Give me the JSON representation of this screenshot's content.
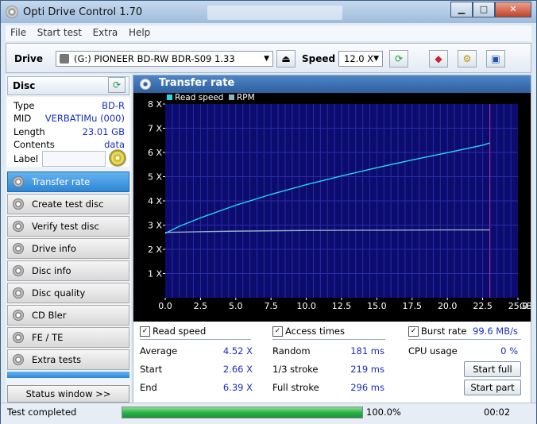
{
  "window": {
    "title": "Opti Drive Control 1.70",
    "min": "▁",
    "max": "□",
    "close": "✕"
  },
  "menu": [
    "File",
    "Start test",
    "Extra",
    "Help"
  ],
  "toolbar": {
    "drive_label": "Drive",
    "drive_value": "(G:)  PIONEER BD-RW   BDR-S09 1.33",
    "speed_label": "Speed",
    "speed_value": "12.0 X"
  },
  "disc": {
    "header": "Disc",
    "rows": [
      {
        "label": "Type",
        "value": "BD-R"
      },
      {
        "label": "MID",
        "value": "VERBATIMu (000)"
      },
      {
        "label": "Length",
        "value": "23.01 GB"
      },
      {
        "label": "Contents",
        "value": "data"
      }
    ],
    "label_field": "Label"
  },
  "nav": [
    {
      "label": "Transfer rate",
      "active": true
    },
    {
      "label": "Create test disc",
      "active": false
    },
    {
      "label": "Verify test disc",
      "active": false
    },
    {
      "label": "Drive info",
      "active": false
    },
    {
      "label": "Disc info",
      "active": false
    },
    {
      "label": "Disc quality",
      "active": false
    },
    {
      "label": "CD Bler",
      "active": false
    },
    {
      "label": "FE / TE",
      "active": false
    },
    {
      "label": "Extra tests",
      "active": false
    }
  ],
  "status_window_button": "Status window >>",
  "panel": {
    "title": "Transfer rate"
  },
  "chart_data": {
    "type": "line",
    "legend": [
      "Read speed",
      "RPM"
    ],
    "x_ticks": [
      "0.0",
      "2.5",
      "5.0",
      "7.5",
      "10.0",
      "12.5",
      "15.0",
      "17.5",
      "20.0",
      "22.5",
      "25.0"
    ],
    "x_unit": "GB",
    "y_ticks": [
      "1 X",
      "2 X",
      "3 X",
      "4 X",
      "5 X",
      "6 X",
      "7 X",
      "8 X"
    ],
    "xlim": [
      0,
      25
    ],
    "ylim": [
      0,
      8
    ],
    "grid": true,
    "marker_x": 23.01,
    "series": [
      {
        "name": "Read speed",
        "color": "#23d8e8",
        "x": [
          0,
          1,
          2.5,
          5,
          7.5,
          10,
          12.5,
          15,
          17.5,
          20,
          22.5,
          23.01
        ],
        "y": [
          2.66,
          2.95,
          3.3,
          3.82,
          4.27,
          4.67,
          5.03,
          5.37,
          5.69,
          5.99,
          6.3,
          6.39
        ]
      },
      {
        "name": "RPM",
        "color": "#8fb2c0",
        "x": [
          0,
          5,
          10,
          15,
          20,
          23.01
        ],
        "y": [
          2.7,
          2.75,
          2.78,
          2.79,
          2.8,
          2.8
        ]
      }
    ]
  },
  "stats": {
    "read_speed_chk": "Read speed",
    "access_times_chk": "Access times",
    "burst_rate_chk": "Burst rate",
    "burst_rate_value": "99.6 MB/s",
    "average_label": "Average",
    "average_value": "4.52 X",
    "start_label": "Start",
    "start_value": "2.66 X",
    "end_label": "End",
    "end_value": "6.39 X",
    "random_label": "Random",
    "random_value": "181 ms",
    "third_label": "1/3 stroke",
    "third_value": "219 ms",
    "full_label": "Full stroke",
    "full_value": "296 ms",
    "cpu_label": "CPU usage",
    "cpu_value": "0 %",
    "start_full": "Start full",
    "start_part": "Start part"
  },
  "statusbar": {
    "text": "Test completed",
    "progress": 100,
    "progress_text": "100.0%",
    "time": "00:02"
  }
}
